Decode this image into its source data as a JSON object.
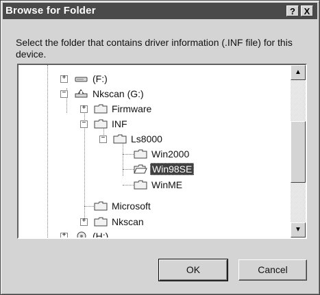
{
  "dialog": {
    "title": "Browse for Folder",
    "help_label": "?",
    "close_label": "X",
    "instructions": "Select the folder that contains driver information (.INF file) for this device."
  },
  "tree": {
    "items": [
      {
        "label": "(F:)",
        "icon": "drive-icon",
        "expander": "+"
      },
      {
        "label": "Nkscan (G:)",
        "icon": "network-drive-icon",
        "expander": "−"
      },
      {
        "label": "Firmware",
        "icon": "folder-icon",
        "expander": "+"
      },
      {
        "label": "INF",
        "icon": "folder-icon",
        "expander": "−"
      },
      {
        "label": "Ls8000",
        "icon": "folder-icon",
        "expander": "−"
      },
      {
        "label": "Win2000",
        "icon": "folder-icon"
      },
      {
        "label": "Win98SE",
        "icon": "folder-icon",
        "selected": true
      },
      {
        "label": "WinME",
        "icon": "folder-icon"
      },
      {
        "label": "Microsoft",
        "icon": "folder-icon"
      },
      {
        "label": "Nkscan",
        "icon": "folder-icon",
        "expander": "+"
      },
      {
        "label": "(H:)",
        "icon": "cd-drive-icon",
        "expander": "+"
      }
    ]
  },
  "scrollbar": {
    "up_arrow": "▲",
    "down_arrow": "▼"
  },
  "buttons": {
    "ok_label": "OK",
    "cancel_label": "Cancel"
  }
}
